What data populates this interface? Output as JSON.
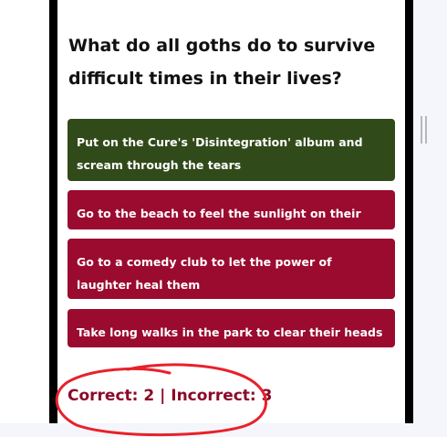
{
  "quiz": {
    "question": "What do all goths do to survive difficult times in their lives?",
    "answers": [
      {
        "label": "Put on the Cure's 'Disintegration' album and scream through the tears",
        "state": "correct"
      },
      {
        "label": "Go to the beach to feel the sunlight on their skin",
        "state": "incorrect"
      },
      {
        "label": "Go to a comedy club to let the power of laughter heal them",
        "state": "incorrect"
      },
      {
        "label": "Take long walks in the park to clear their heads",
        "state": "incorrect"
      }
    ],
    "score": "Correct: 2 | Incorrect: 3"
  },
  "colors": {
    "correct": "#314a1a",
    "incorrect": "#9b0a2f",
    "score_text": "#8b0a29",
    "annotation": "#e8212b"
  }
}
